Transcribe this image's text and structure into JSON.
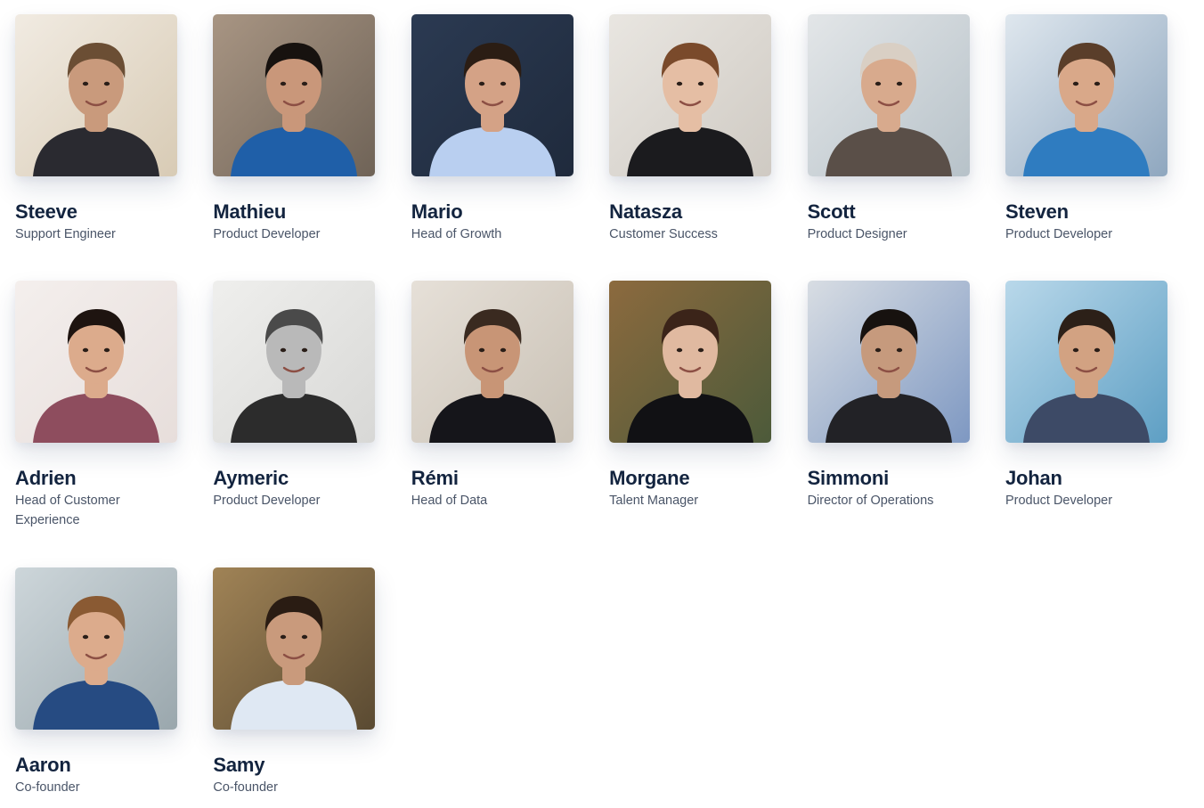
{
  "members": [
    {
      "name": "Steeve",
      "role": "Support Engineer",
      "bg": "#d8cbb5",
      "bg2": "#f1ebe2",
      "skin": "#c99a7c",
      "hair": "#6b4e34",
      "shirt": "#2a2a30"
    },
    {
      "name": "Mathieu",
      "role": "Product Developer",
      "bg": "#6f6357",
      "bg2": "#a89583",
      "skin": "#c9977a",
      "hair": "#17120f",
      "shirt": "#1f5fa8"
    },
    {
      "name": "Mario",
      "role": "Head of Growth",
      "bg": "#1f2a3c",
      "bg2": "#2b3a52",
      "skin": "#d4a286",
      "hair": "#2b1d14",
      "shirt": "#b9cff0"
    },
    {
      "name": "Natasza",
      "role": "Customer Success",
      "bg": "#cfcac3",
      "bg2": "#e9e6e1",
      "skin": "#e5bea4",
      "hair": "#7a4a2b",
      "shirt": "#1b1b1e"
    },
    {
      "name": "Scott",
      "role": "Product Designer",
      "bg": "#b7c2c9",
      "bg2": "#e3e6e8",
      "skin": "#d8aa8d",
      "hair": "#d9cfc4",
      "shirt": "#5a4f48"
    },
    {
      "name": "Steven",
      "role": "Product Developer",
      "bg": "#8fa7bf",
      "bg2": "#dfe7ee",
      "skin": "#d9a889",
      "hair": "#5a3e2a",
      "shirt": "#2f7cc0"
    },
    {
      "name": "Adrien",
      "role": "Head of Customer Experience",
      "bg": "#e7dedb",
      "bg2": "#f4efed",
      "skin": "#dcab8c",
      "hair": "#1e1410",
      "shirt": "#8e4d5e"
    },
    {
      "name": "Aymeric",
      "role": "Product Developer",
      "bg": "#d8d8d6",
      "bg2": "#efefed",
      "skin": "#b9b9b9",
      "hair": "#4a4a4a",
      "shirt": "#2c2c2c"
    },
    {
      "name": "Rémi",
      "role": "Head of Data",
      "bg": "#c9c1b5",
      "bg2": "#e6e0d8",
      "skin": "#c89576",
      "hair": "#3a2a20",
      "shirt": "#15151a"
    },
    {
      "name": "Morgane",
      "role": "Talent Manager",
      "bg": "#4c5a3a",
      "bg2": "#8c6a3e",
      "skin": "#e0b9a0",
      "hair": "#3b2419",
      "shirt": "#111114"
    },
    {
      "name": "Simmoni",
      "role": "Director of Operations",
      "bg": "#7e98c2",
      "bg2": "#d8dde3",
      "skin": "#c69a7d",
      "hair": "#17120f",
      "shirt": "#222226"
    },
    {
      "name": "Johan",
      "role": "Product Developer",
      "bg": "#5e9fc4",
      "bg2": "#b9d8ea",
      "skin": "#d2a282",
      "hair": "#2c2018",
      "shirt": "#3d4a66"
    },
    {
      "name": "Aaron",
      "role": "Co-founder",
      "bg": "#9aa7ad",
      "bg2": "#cdd6da",
      "skin": "#dcab8c",
      "hair": "#8a5a33",
      "shirt": "#264b82"
    },
    {
      "name": "Samy",
      "role": "Co-founder",
      "bg": "#5a4a32",
      "bg2": "#a08356",
      "skin": "#c99a7c",
      "hair": "#2a1c13",
      "shirt": "#dfe8f3"
    }
  ]
}
